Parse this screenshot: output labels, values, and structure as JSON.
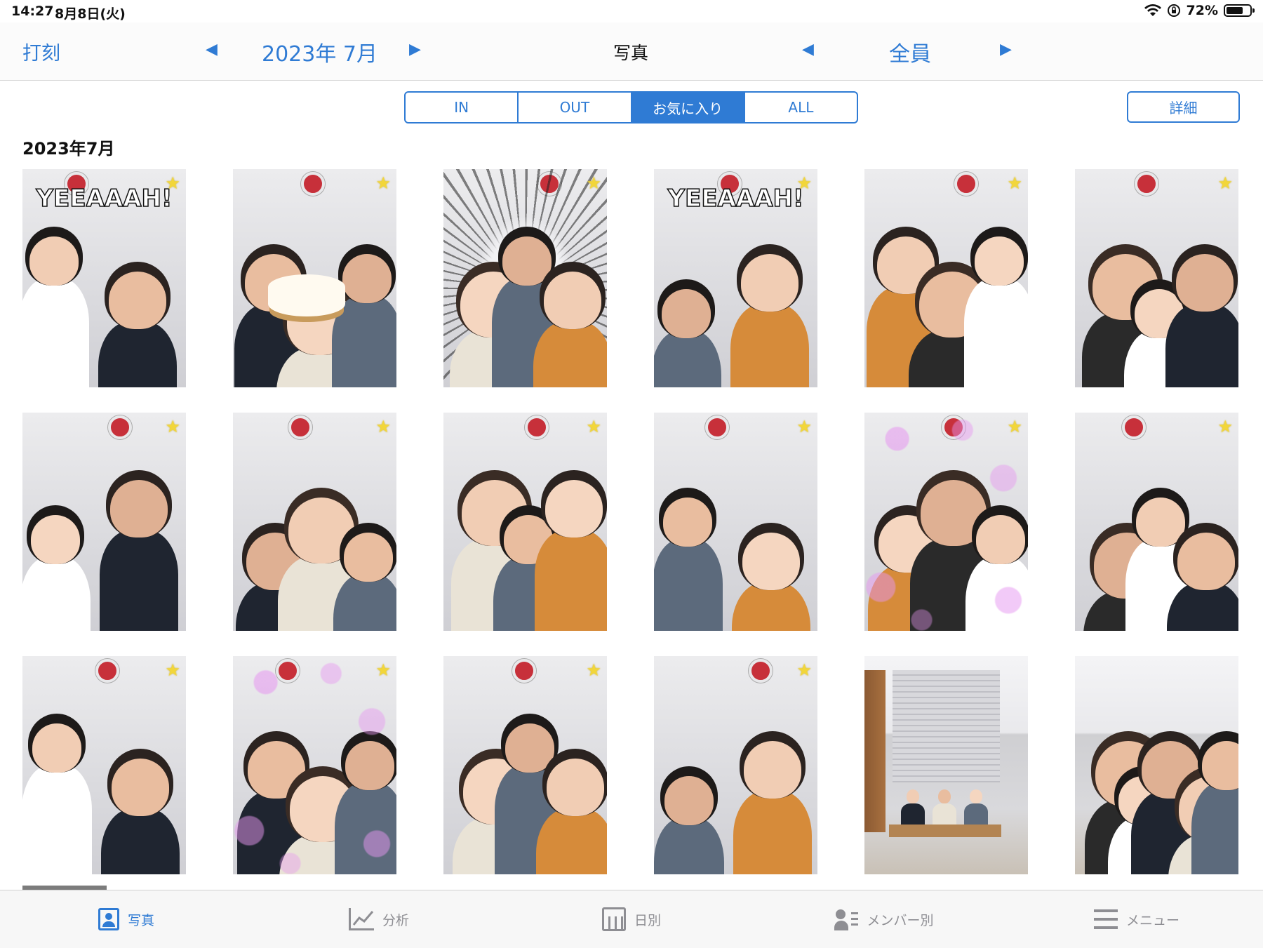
{
  "status": {
    "time": "14:27",
    "date": "8月8日(火)",
    "battery": "72%",
    "battery_level": 0.72
  },
  "nav": {
    "left_label": "打刻",
    "month": "2023年 7月",
    "title": "写真",
    "member_filter": "全員",
    "prev_arrow": "◀",
    "next_arrow": "▶"
  },
  "segments": [
    {
      "label": "IN",
      "active": false
    },
    {
      "label": "OUT",
      "active": false
    },
    {
      "label": "お気に入り",
      "active": true
    },
    {
      "label": "ALL",
      "active": false
    }
  ],
  "detail_label": "詳細",
  "section_title": "2023年7月",
  "photos": [
    {
      "caption": "YEEAAAH!",
      "favorite": true,
      "effect": "none"
    },
    {
      "caption": "",
      "favorite": true,
      "effect": "cake"
    },
    {
      "caption": "",
      "favorite": true,
      "effect": "burst"
    },
    {
      "caption": "YEEAAAH!",
      "favorite": true,
      "effect": "none"
    },
    {
      "caption": "",
      "favorite": true,
      "effect": "none"
    },
    {
      "caption": "",
      "favorite": true,
      "effect": "none"
    },
    {
      "caption": "",
      "favorite": true,
      "effect": "none"
    },
    {
      "caption": "",
      "favorite": true,
      "effect": "none"
    },
    {
      "caption": "",
      "favorite": true,
      "effect": "none"
    },
    {
      "caption": "",
      "favorite": true,
      "effect": "none"
    },
    {
      "caption": "",
      "favorite": true,
      "effect": "bubbles"
    },
    {
      "caption": "",
      "favorite": true,
      "effect": "none"
    },
    {
      "caption": "",
      "favorite": true,
      "effect": "none"
    },
    {
      "caption": "",
      "favorite": true,
      "effect": "bubbles"
    },
    {
      "caption": "",
      "favorite": true,
      "effect": "none"
    },
    {
      "caption": "",
      "favorite": true,
      "effect": "none"
    },
    {
      "caption": "",
      "favorite": false,
      "effect": "room"
    },
    {
      "caption": "",
      "favorite": false,
      "effect": "group"
    }
  ],
  "tabs": [
    {
      "label": "写真",
      "icon": "photo-icon",
      "active": true
    },
    {
      "label": "分析",
      "icon": "chart-icon",
      "active": false
    },
    {
      "label": "日別",
      "icon": "calendar-icon",
      "active": false
    },
    {
      "label": "メンバー別",
      "icon": "member-icon",
      "active": false
    },
    {
      "label": "メニュー",
      "icon": "menu-icon",
      "active": false
    }
  ],
  "colors": {
    "accent": "#2f7bd4",
    "star": "#f2d63a",
    "inactive": "#8e8e93"
  }
}
